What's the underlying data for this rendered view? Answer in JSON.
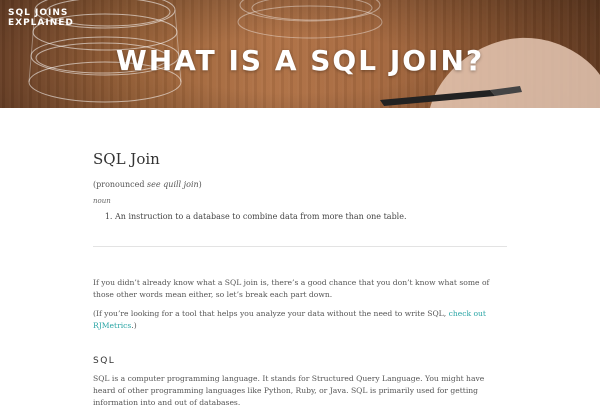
{
  "header": {
    "brand_line1": "SQL JOINS",
    "brand_line2": "EXPLAINED",
    "title": "WHAT IS A SQL JOIN?"
  },
  "definition": {
    "term": "SQL Join",
    "pronounced_prefix": "(pronounced ",
    "pronounced_value": "see quill join",
    "pronounced_suffix": ")",
    "part_of_speech": "noun",
    "items": [
      "An instruction to a database to combine data from more than one table."
    ]
  },
  "intro": {
    "paragraph1": "If you didn’t already know what a SQL join is, there’s a good chance that you don’t know what some of those other words mean either, so let’s break each part down.",
    "paragraph2_prefix": "(If you’re looking for a tool that helps you analyze your data without the need to write SQL, ",
    "paragraph2_link": "check out RJMetrics",
    "paragraph2_suffix": ".)"
  },
  "sql_section": {
    "heading": "SQL",
    "paragraph": "SQL is a computer programming language. It stands for Structured Query Language. You might have heard of other programming languages like Python, Ruby, or Java.  SQL is primarily used for getting information into and out of databases."
  },
  "colors": {
    "link": "#2aa5a5",
    "hero_text": "#ffffff"
  }
}
